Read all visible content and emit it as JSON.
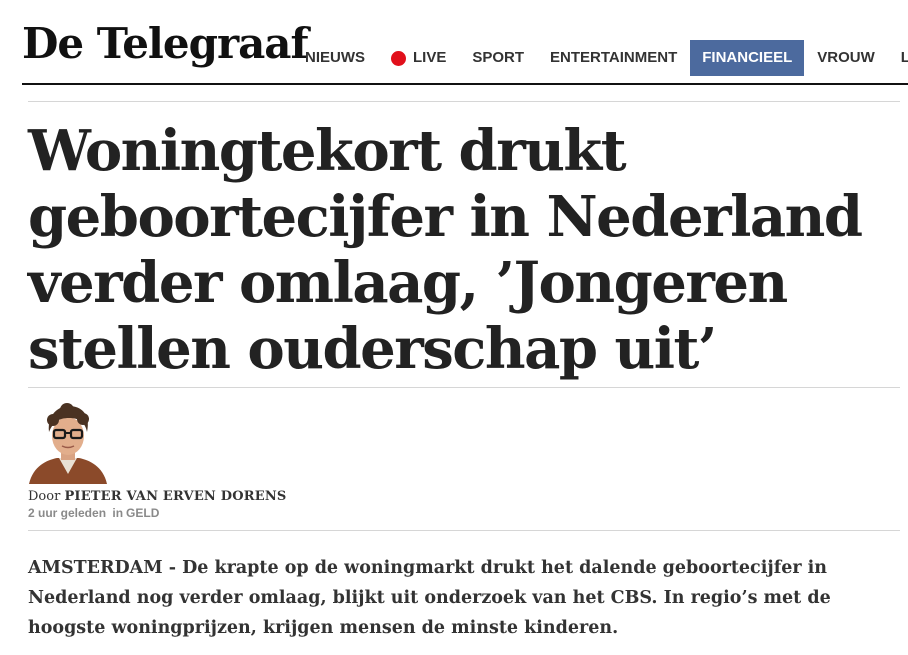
{
  "brand": {
    "logo_text": "De Telegraaf"
  },
  "nav": {
    "items": [
      {
        "label": "NIEUWS",
        "active": false
      },
      {
        "label": "LIVE",
        "active": false
      },
      {
        "label": "SPORT",
        "active": false
      },
      {
        "label": "ENTERTAINMENT",
        "active": false
      },
      {
        "label": "FINANCIEEL",
        "active": true
      },
      {
        "label": "VROUW",
        "active": false
      },
      {
        "label": "LIFES",
        "active": false
      }
    ],
    "active_color": "#4c6a9e",
    "live_dot_color": "#e1101b"
  },
  "article": {
    "headline": "Woningtekort drukt geboortecijfer in Nederland verder omlaag, ’Jongeren stellen ouderschap uit’",
    "byline_prefix": "Door",
    "author": "PIETER VAN ERVEN DORENS",
    "time_ago": "2 uur geleden",
    "section_prefix": "in",
    "section": "GELD",
    "lead": "AMSTERDAM - De krapte op de woningmarkt drukt het dalende geboortecijfer in Nederland nog verder omlaag, blijkt uit onderzoek van het CBS. In regio’s met de hoogste woningprijzen, krijgen mensen de minste kinderen."
  },
  "icons": {
    "live": "red-dot-icon",
    "author": "author-avatar"
  }
}
